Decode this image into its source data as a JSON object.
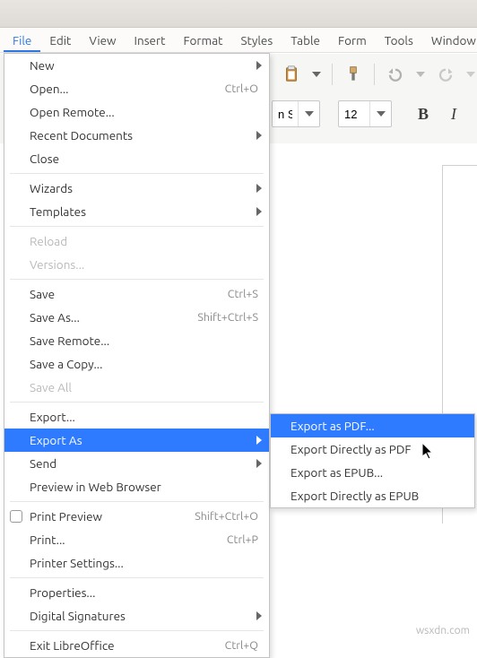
{
  "menubar": {
    "file": "File",
    "edit": "Edit",
    "view": "View",
    "insert": "Insert",
    "format": "Format",
    "styles": "Styles",
    "table": "Table",
    "form": "Form",
    "tools": "Tools",
    "window": "Window"
  },
  "toolbar": {
    "font_name_visible": "n Se",
    "font_size": "12"
  },
  "file_menu": {
    "new": "New",
    "open": "Open...",
    "open_accel": "Ctrl+O",
    "open_remote": "Open Remote...",
    "recent": "Recent Documents",
    "close": "Close",
    "wizards": "Wizards",
    "templates": "Templates",
    "reload": "Reload",
    "versions": "Versions...",
    "save": "Save",
    "save_accel": "Ctrl+S",
    "save_as": "Save As...",
    "save_as_accel": "Shift+Ctrl+S",
    "save_remote": "Save Remote...",
    "save_copy": "Save a Copy...",
    "save_all": "Save All",
    "export": "Export...",
    "export_as": "Export As",
    "send": "Send",
    "preview_browser": "Preview in Web Browser",
    "print_preview": "Print Preview",
    "print_preview_accel": "Shift+Ctrl+O",
    "print": "Print...",
    "print_accel": "Ctrl+P",
    "printer_settings": "Printer Settings...",
    "properties": "Properties...",
    "digital_sigs": "Digital Signatures",
    "exit": "Exit LibreOffice",
    "exit_accel": "Ctrl+Q"
  },
  "export_submenu": {
    "as_pdf": "Export as PDF...",
    "directly_pdf": "Export Directly as PDF",
    "as_epub": "Export as EPUB...",
    "directly_epub": "Export Directly as EPUB"
  },
  "watermark": "wsxdn.com"
}
